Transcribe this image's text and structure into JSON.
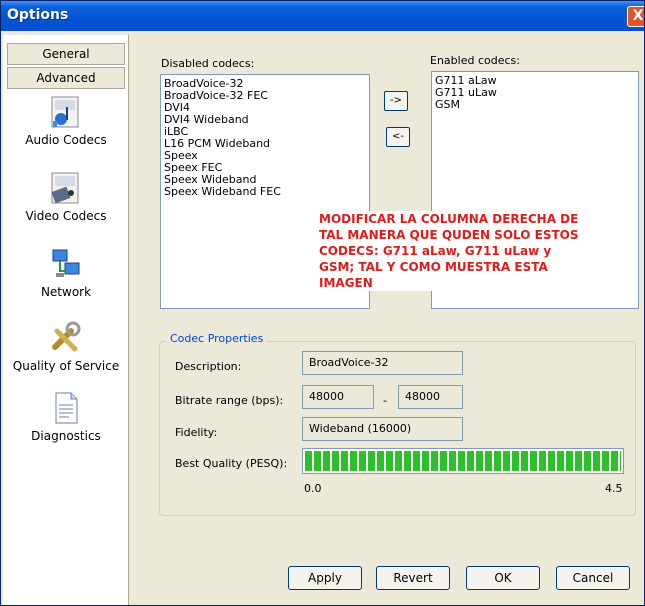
{
  "window": {
    "title": "Options",
    "close_glyph": "X"
  },
  "sidebar": {
    "tabs": [
      "General",
      "Advanced"
    ],
    "items": [
      {
        "label": "Audio Codecs",
        "icon": "audio-codecs-icon"
      },
      {
        "label": "Video Codecs",
        "icon": "video-codecs-icon"
      },
      {
        "label": "Network",
        "icon": "network-icon"
      },
      {
        "label": "Quality of Service",
        "icon": "quality-of-service-icon"
      },
      {
        "label": "Diagnostics",
        "icon": "diagnostics-icon"
      }
    ]
  },
  "codecs": {
    "disabled_label": "Disabled codecs:",
    "enabled_label": "Enabled codecs:",
    "disabled": [
      "BroadVoice-32",
      "BroadVoice-32 FEC",
      "DVI4",
      "DVI4 Wideband",
      "iLBC",
      "L16 PCM Wideband",
      "Speex",
      "Speex FEC",
      "Speex Wideband",
      "Speex Wideband FEC"
    ],
    "enabled": [
      "G711 aLaw",
      "G711 uLaw",
      "GSM"
    ],
    "move_right": "->",
    "move_left": "<-"
  },
  "annotation": "MODIFICAR LA COLUMNA DERECHA DE TAL MANERA QUE QUDEN SOLO ESTOS CODECS: G711 aLaw, G711 uLaw y GSM; TAL Y COMO MUESTRA ESTA IMAGEN",
  "codec_properties": {
    "title": "Codec Properties",
    "description_label": "Description:",
    "description_value": "BroadVoice-32",
    "bitrate_label": "Bitrate range (bps):",
    "bitrate_min": "48000",
    "bitrate_sep": "-",
    "bitrate_max": "48000",
    "fidelity_label": "Fidelity:",
    "fidelity_value": "Wideband (16000)",
    "quality_label": "Best Quality (PESQ):",
    "quality_fraction": 1.0,
    "scale_min": "0.0",
    "scale_max": "4.5"
  },
  "buttons": {
    "apply": "Apply",
    "revert": "Revert",
    "ok": "OK",
    "cancel": "Cancel"
  },
  "colors": {
    "titlebar": "#0554d8",
    "annotation": "#dd1c1c",
    "quality_bar": "#2ec02a",
    "group_title": "#0046d5"
  }
}
